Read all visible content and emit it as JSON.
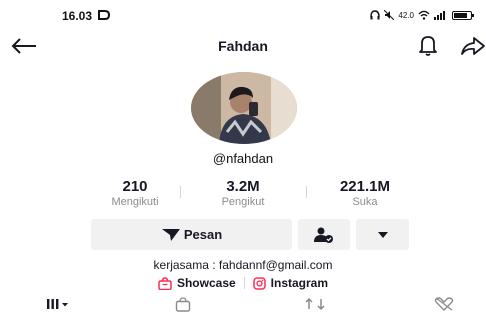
{
  "status_bar": {
    "time": "16.03",
    "network_speed": "42.0"
  },
  "header": {
    "title": "Fahdan"
  },
  "profile": {
    "username": "@nfahdan"
  },
  "stats": [
    {
      "value": "210",
      "label": "Mengikuti"
    },
    {
      "value": "3.2M",
      "label": "Pengikut"
    },
    {
      "value": "221.1M",
      "label": "Suka"
    }
  ],
  "actions": {
    "message_label": "Pesan"
  },
  "bio": {
    "text": "kerjasama : fahdannf@gmail.com"
  },
  "links": {
    "showcase_label": "Showcase",
    "instagram_label": "Instagram"
  },
  "colors": {
    "accent": "#fe2c55",
    "button_bg": "#f1f1f2",
    "muted_text": "#8a8b91"
  },
  "icons": [
    "back-arrow-icon",
    "bell-icon",
    "share-icon",
    "send-icon",
    "user-check-icon",
    "caret-down-icon",
    "shopping-bag-icon",
    "instagram-icon",
    "grid-icon",
    "bag-icon",
    "repost-icon",
    "liked-heart-icon"
  ]
}
